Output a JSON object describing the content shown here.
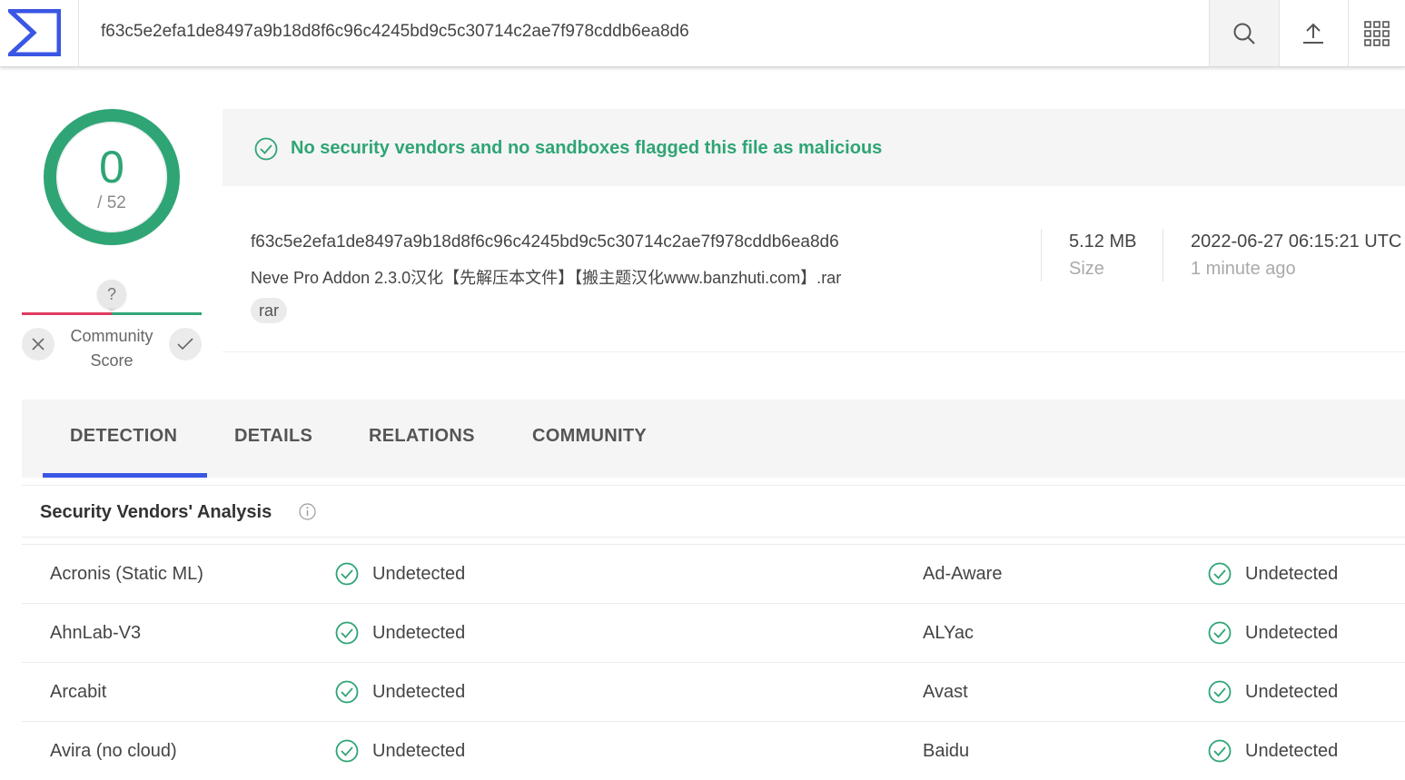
{
  "topbar": {
    "search_value": "f63c5e2efa1de8497a9b18d8f6c96c4245bd9c5c30714c2ae7f978cddb6ea8d6",
    "icons": [
      "sigma-logo-icon",
      "search-icon",
      "upload-icon",
      "apps-grid-icon"
    ],
    "brand_color": "#3a56e4"
  },
  "score": {
    "detected": "0",
    "total": "/ 52",
    "color": "#2fa575"
  },
  "community": {
    "unknown_symbol": "?",
    "label": "Community Score"
  },
  "banner": {
    "text": "No security vendors and no sandboxes flagged this file as malicious"
  },
  "file": {
    "hash": "f63c5e2efa1de8497a9b18d8f6c96c4245bd9c5c30714c2ae7f978cddb6ea8d6",
    "name": "Neve Pro Addon 2.3.0汉化【先解压本文件】【搬主题汉化www.banzhuti.com】.rar",
    "tag": "rar",
    "size_value": "5.12 MB",
    "size_label": "Size",
    "date_value": "2022-06-27 06:15:21 UTC",
    "date_label": "1 minute ago"
  },
  "tabs": [
    {
      "label": "DETECTION",
      "active": true
    },
    {
      "label": "DETAILS",
      "active": false
    },
    {
      "label": "RELATIONS",
      "active": false
    },
    {
      "label": "COMMUNITY",
      "active": false
    }
  ],
  "section": {
    "title": "Security Vendors' Analysis"
  },
  "vendors": [
    {
      "left_name": "Acronis (Static ML)",
      "left_result": "Undetected",
      "right_name": "Ad-Aware",
      "right_result": "Undetected"
    },
    {
      "left_name": "AhnLab-V3",
      "left_result": "Undetected",
      "right_name": "ALYac",
      "right_result": "Undetected"
    },
    {
      "left_name": "Arcabit",
      "left_result": "Undetected",
      "right_name": "Avast",
      "right_result": "Undetected"
    },
    {
      "left_name": "Avira (no cloud)",
      "left_result": "Undetected",
      "right_name": "Baidu",
      "right_result": "Undetected"
    }
  ]
}
